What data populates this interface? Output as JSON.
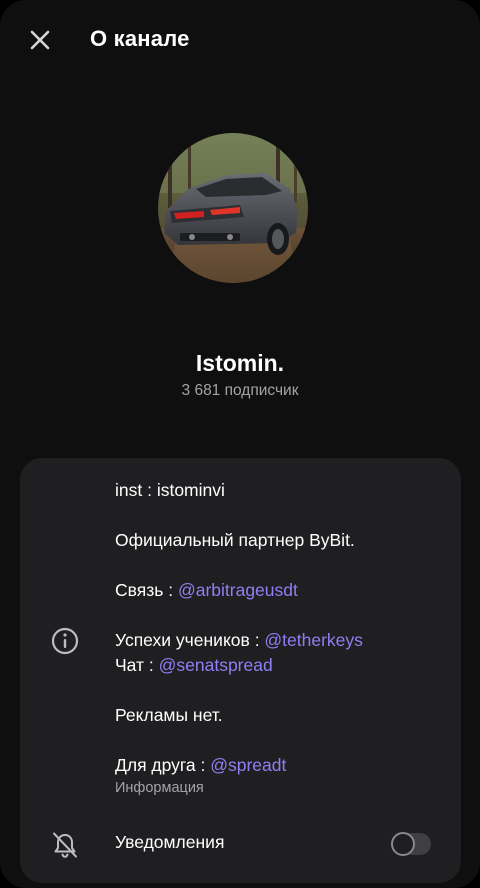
{
  "header": {
    "title": "О канале",
    "close_icon": "close-icon"
  },
  "channel": {
    "name": "Istomin.",
    "subscribers": "3 681 подписчик"
  },
  "description": {
    "line1": "inst : istominvi",
    "line2": "Официальный партнер ByBit.",
    "line3_label": "Связь : ",
    "line3_link": "@arbitrageusdt",
    "line4_label": "Успехи учеников : ",
    "line4_link": "@tetherkeys",
    "line5_label": "Чат : ",
    "line5_link": "@senatspread",
    "line6": "Рекламы нет.",
    "line7_label": "Для друга : ",
    "line7_link": "@spreadt",
    "info_label": "Информация",
    "icon": "info-circle-icon"
  },
  "notifications": {
    "label": "Уведомления",
    "icon": "bell-off-icon",
    "enabled": false
  },
  "colors": {
    "background": "#0f0f10",
    "card": "#1f1f21",
    "link": "#8f7ff5",
    "secondary_text": "#a4a4a8"
  }
}
